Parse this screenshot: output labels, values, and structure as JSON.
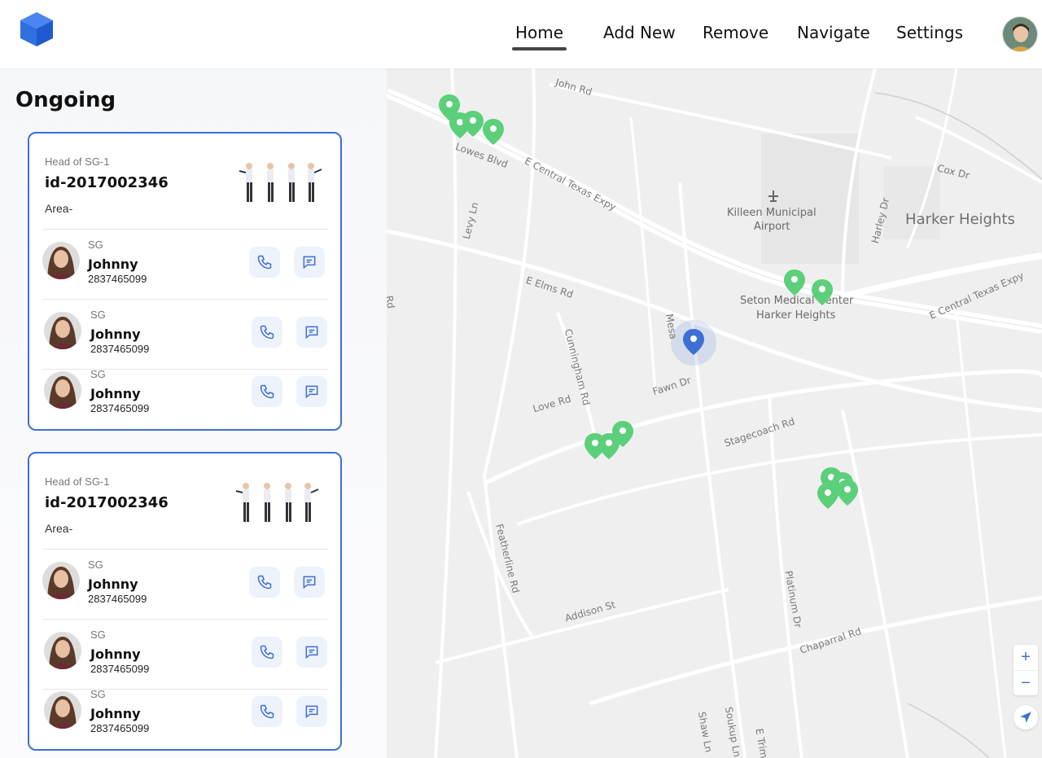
{
  "header": {
    "nav": [
      {
        "label": "Home",
        "active": true
      },
      {
        "label": "Add New",
        "active": false
      },
      {
        "label": "Remove",
        "active": false
      },
      {
        "label": "Navigate",
        "active": false
      },
      {
        "label": "Settings",
        "active": false
      }
    ],
    "logo_icon": "cube-logo-icon",
    "avatar_icon": "user-avatar"
  },
  "sidebar": {
    "title": "Ongoing",
    "cards": [
      {
        "head_label": "Head of SG-1",
        "id": "id-2017002346",
        "area": "Area-",
        "members": [
          {
            "role": "SG",
            "name": "Johnny",
            "phone": "2837465099"
          },
          {
            "role": "SG",
            "name": "Johnny",
            "phone": "2837465099"
          },
          {
            "role": "SG",
            "name": "Johnny",
            "phone": "2837465099"
          }
        ]
      },
      {
        "head_label": "Head of SG-1",
        "id": "id-2017002346",
        "area": "Area-",
        "members": [
          {
            "role": "SG",
            "name": "Johnny",
            "phone": "2837465099"
          },
          {
            "role": "SG",
            "name": "Johnny",
            "phone": "2837465099"
          },
          {
            "role": "SG",
            "name": "Johnny",
            "phone": "2837465099"
          }
        ]
      }
    ]
  },
  "map": {
    "labels": {
      "john_rd": "John Rd",
      "lowes_blvd": "Lowes Blvd",
      "e_central_texas_expy": "E Central Texas Expy",
      "e_central_texas_expy_2": "E Central Texas Expy",
      "cox_dr": "Cox Dr",
      "harley_dr": "Harley Dr",
      "harker_heights": "Harker Heights",
      "airport_line1": "Killeen Municipal",
      "airport_line2": "Airport",
      "hospital_line1": "Seton Medical Center",
      "hospital_line2": "Harker Heights",
      "levy_ln": "Levy Ln",
      "e_elms_rd": "E Elms Rd",
      "cunningham_rd": "Cunningham Rd",
      "love_rd": "Love Rd",
      "fawn_dr": "Fawn Dr",
      "stagecoach_rd": "Stagecoach Rd",
      "featherline_rd": "Featherline Rd",
      "addison_st": "Addison St",
      "platinum_dr": "Platinum Dr",
      "chaparral_rd": "Chaparral Rd",
      "shaw_ln": "Shaw Ln",
      "soukup_ln": "Soukup Ln",
      "e_trimmier": "E Trim",
      "rd_edge": "Rd",
      "mesa": "Mesa"
    },
    "zoom_in": "+",
    "zoom_out": "−",
    "colors": {
      "pin": "#5ccf7a",
      "current": "#3d6fd6",
      "accent": "#3d6fd6"
    }
  }
}
